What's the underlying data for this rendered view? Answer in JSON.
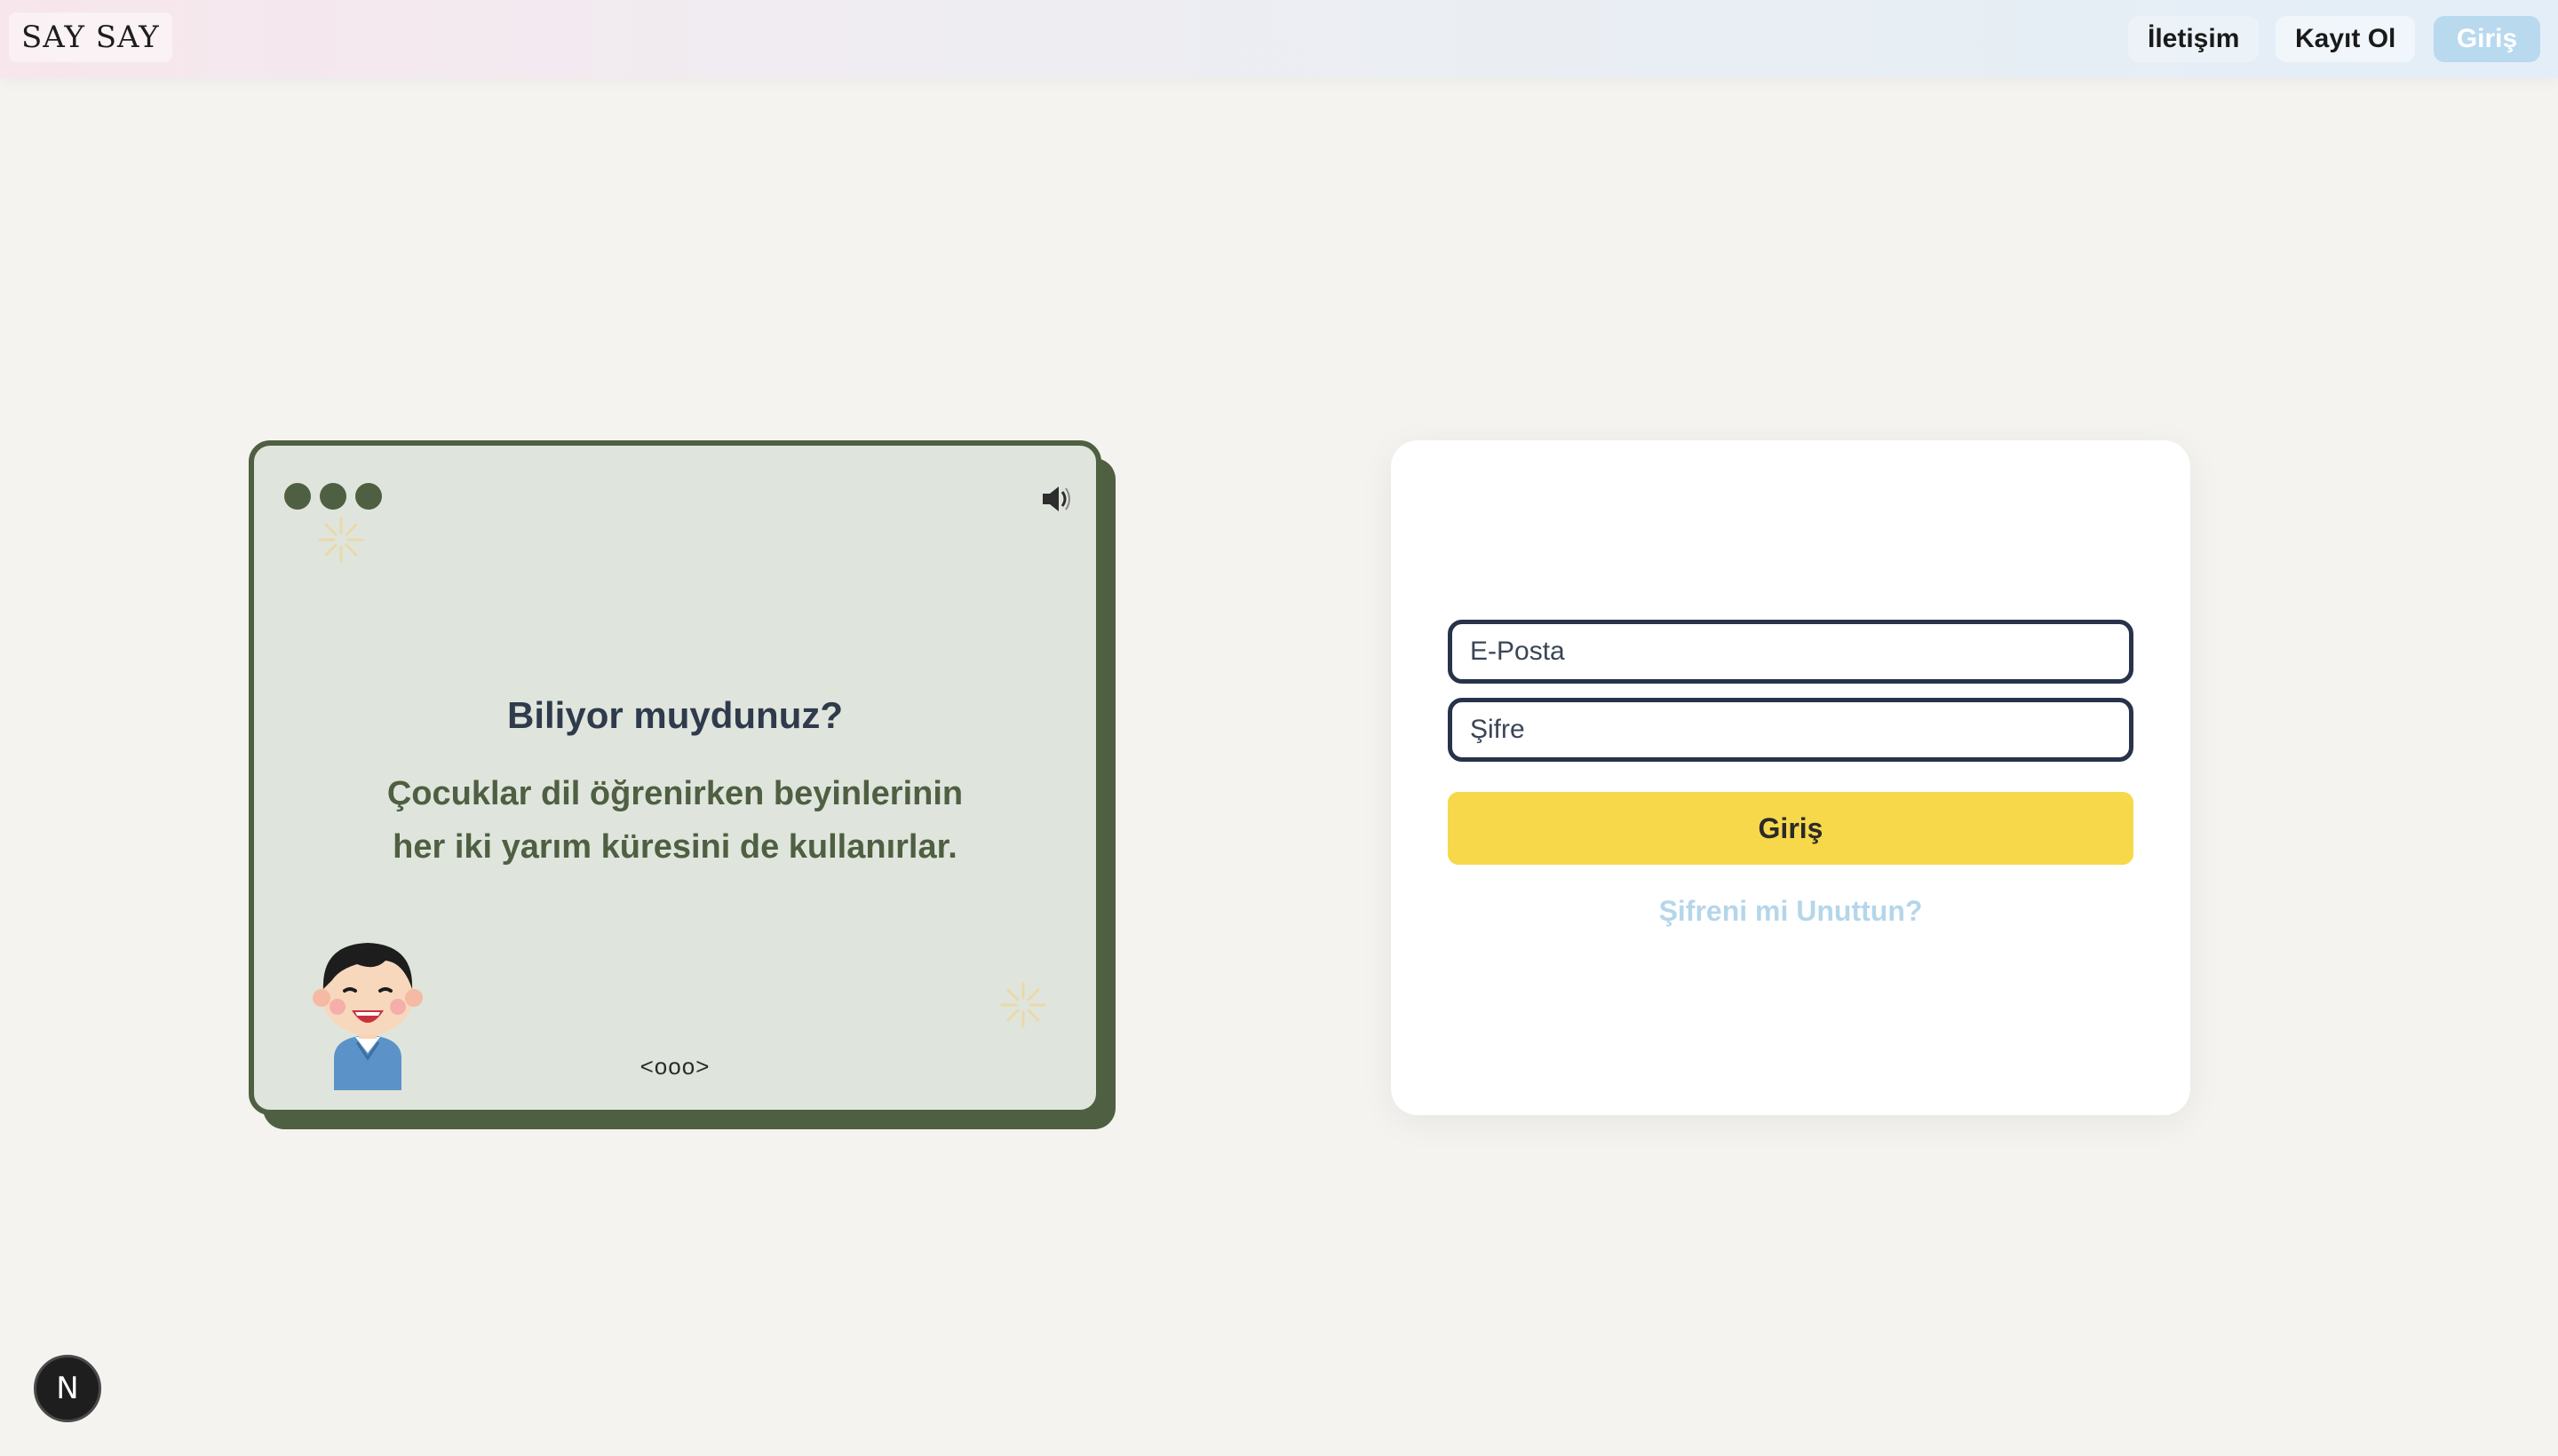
{
  "header": {
    "logo": "SAY SAY",
    "nav": {
      "contact": "İletişim",
      "register": "Kayıt Ol",
      "login": "Giriş"
    }
  },
  "fact_card": {
    "title": "Biliyor muydunuz?",
    "text": "Çocuklar dil öğrenirken beyinlerinin her iki yarım küresini de kullanırlar.",
    "pager": "<ooo>",
    "icons": [
      "window-dots",
      "sparkle",
      "speaker-icon",
      "boy-illustration"
    ]
  },
  "login_form": {
    "email_placeholder": "E-Posta",
    "password_placeholder": "Şifre",
    "submit_label": "Giriş",
    "forgot_link": "Şifreni mi Unuttun?"
  },
  "badge": {
    "label": "N"
  },
  "colors": {
    "background": "#f4f3ef",
    "card_green": "#4f5f42",
    "card_fill": "#dfe5dc",
    "accent_yellow": "#f7d84a",
    "link_blue": "#b5d6ea",
    "nav_active": "#b9d9ef"
  }
}
